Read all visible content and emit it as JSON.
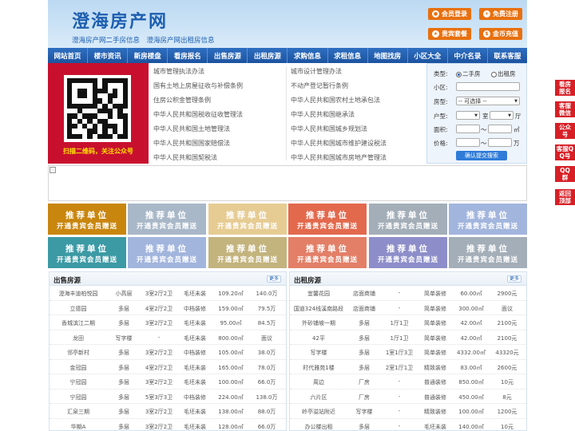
{
  "header": {
    "logo": "澄海房产网",
    "subtitle": "澄海房产网二手房信息　澄海房产网出租房信息",
    "buttons": [
      {
        "label": "会员登录",
        "icon": "user-icon"
      },
      {
        "label": "免费注册",
        "icon": "register-icon"
      },
      {
        "label": "贵宾套餐",
        "icon": "vip-icon"
      },
      {
        "label": "金币充值",
        "icon": "coin-icon"
      }
    ]
  },
  "nav": [
    "网站首页",
    "楼市资讯",
    "新房楼盘",
    "看房报名",
    "出售房源",
    "出租房源",
    "求购信息",
    "求租信息",
    "地图找房",
    "小区大全",
    "中介名录",
    "联系客服"
  ],
  "qr": {
    "caption": "扫描二维码，关注公众号"
  },
  "laws": {
    "left": [
      "城市管理执法办法",
      "国有土地上房屋征收与补偿条例",
      "住房公积金管理条例",
      "中华人民共和国税收征收管理法",
      "中华人民共和国土地管理法",
      "中华人民共和国国家赔偿法",
      "中华人民共和国契税法"
    ],
    "right": [
      "城市设计管理办法",
      "不动产登记暂行条例",
      "中华人民共和国农村土地承包法",
      "中华人民共和国继承法",
      "中华人民共和国城乡规划法",
      "中华人民共和国城市维护建设税法",
      "中华人民共和国城市房地产管理法"
    ]
  },
  "search": {
    "type_label": "类型:",
    "type_options": [
      "二手房",
      "出租房"
    ],
    "community_label": "小区:",
    "community_value": "",
    "house_label": "房型:",
    "house_value": "-- 可选择 --",
    "layout_label": "户型:",
    "room_unit": "室",
    "hall_unit": "厅",
    "area_label": "面积:",
    "area_unit": "㎡",
    "range_sep": "～",
    "price_label": "价格:",
    "price_unit": "万",
    "submit_label": "确认提交搜索"
  },
  "tiles": {
    "title": "推荐单位",
    "subtitle": "开通贵宾会员赠送"
  },
  "tile_colors": [
    "#c9860f",
    "#a9b8c8",
    "#e6cc93",
    "#e3694d",
    "#a3aeb8",
    "#a2b5dd",
    "#3c9aa5",
    "#a2b5dd",
    "#c3b37d",
    "#e37f67",
    "#8d8ec9",
    "#a3aeb8",
    "#8ab3d5",
    "#b8aa86"
  ],
  "sale": {
    "title": "出售房源",
    "more": "更多",
    "rows": [
      [
        "澄海丰迪柏悦园",
        "小高层",
        "3室2厅2卫",
        "毛坯未装",
        "109.20㎡",
        "140.0万"
      ],
      [
        "立德园",
        "多层",
        "4室2厅2卫",
        "中档装修",
        "159.00㎡",
        "79.5万"
      ],
      [
        "香城滨江二期",
        "多层",
        "3室2厅2卫",
        "毛坯未装",
        "95.00㎡",
        "84.5万"
      ],
      [
        "龙田",
        "写字楼",
        "-",
        "毛坯未装",
        "800.00㎡",
        "面议"
      ],
      [
        "邻亭新村",
        "多层",
        "3室2厅2卫",
        "中档装修",
        "105.00㎡",
        "38.0万"
      ],
      [
        "金冠园",
        "多层",
        "4室2厅2卫",
        "毛坯未装",
        "165.00㎡",
        "78.0万"
      ],
      [
        "宁冠园",
        "多层",
        "3室2厅2卫",
        "毛坯未装",
        "100.00㎡",
        "66.0万"
      ],
      [
        "宁冠园",
        "多层",
        "5室3厅3卫",
        "中档装修",
        "224.00㎡",
        "138.0万"
      ],
      [
        "汇泉三期",
        "多层",
        "3室2厅2卫",
        "毛坯未装",
        "138.00㎡",
        "88.0万"
      ],
      [
        "华期A",
        "多层",
        "3室2厅2卫",
        "毛坯未装",
        "128.00㎡",
        "66.0万"
      ]
    ]
  },
  "rent": {
    "title": "出租房源",
    "more": "更多",
    "rows": [
      [
        "宜馨花园",
        "店面商铺",
        "-",
        "简单装修",
        "60.00㎡",
        "2900元"
      ],
      [
        "国道324线溪南路段",
        "店面商铺",
        "-",
        "简单装修",
        "300.00㎡",
        "面议"
      ],
      [
        "外砂铺坡一期",
        "多层",
        "1厅1卫",
        "简单装修",
        "42.00㎡",
        "2100元"
      ],
      [
        "42平",
        "多层",
        "1厅1卫",
        "简单装修",
        "42.00㎡",
        "2100元"
      ],
      [
        "写字楼",
        "多层",
        "1室1厅3卫",
        "简单装修",
        "4332.00㎡",
        "43320元"
      ],
      [
        "时代雅苑1楼",
        "多层",
        "2室1厅1卫",
        "精致装修",
        "83.00㎡",
        "2600元"
      ],
      [
        "周边",
        "厂房",
        "-",
        "普通装修",
        "850.00㎡",
        "10元"
      ],
      [
        "六片区",
        "厂房",
        "-",
        "普通装修",
        "450.00㎡",
        "8元"
      ],
      [
        "岭亭溢站附近",
        "写字楼",
        "-",
        "精致装修",
        "100.00㎡",
        "1200元"
      ],
      [
        "办公楼出租",
        "多层",
        "-",
        "毛坯未装",
        "140.00㎡",
        "10元"
      ]
    ]
  },
  "float": [
    "看房报名",
    "客服微信",
    "公众号",
    "客服QQ号",
    "QQ群",
    "返回顶部"
  ]
}
